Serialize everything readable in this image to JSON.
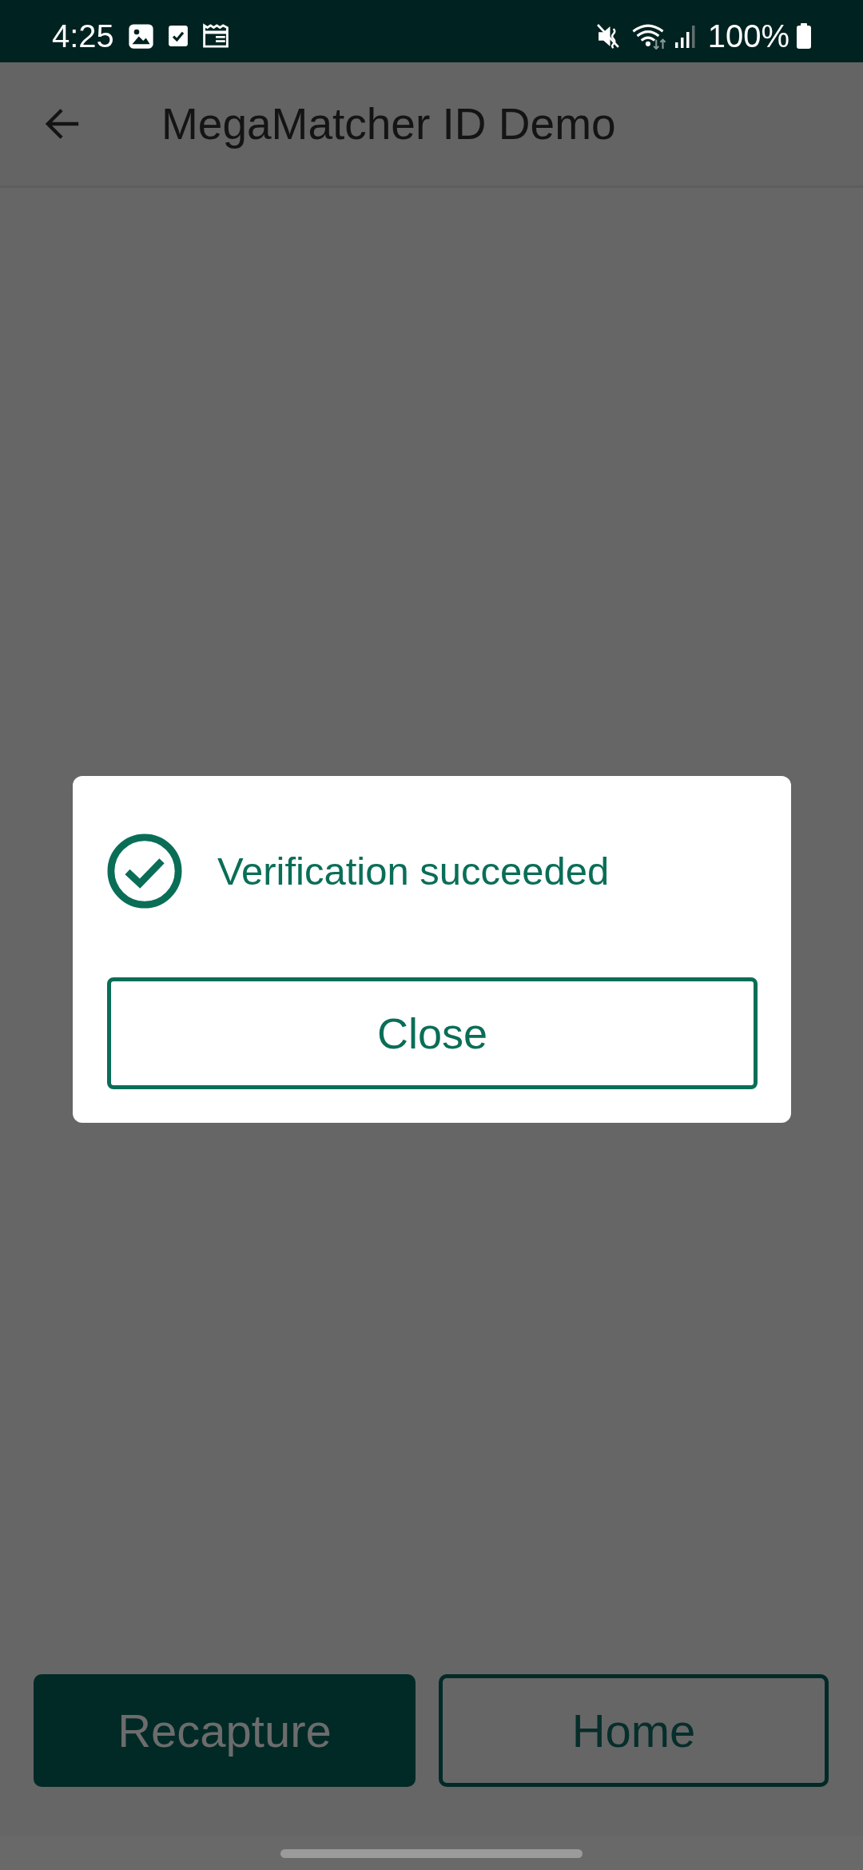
{
  "status_bar": {
    "time": "4:25",
    "battery": "100%"
  },
  "app_bar": {
    "title": "MegaMatcher ID Demo"
  },
  "dialog": {
    "message": "Verification succeeded",
    "button": "Close"
  },
  "bottom_buttons": [
    {
      "label": "Recapture",
      "kind": "filled"
    },
    {
      "label": "Home",
      "kind": "outlined"
    }
  ]
}
